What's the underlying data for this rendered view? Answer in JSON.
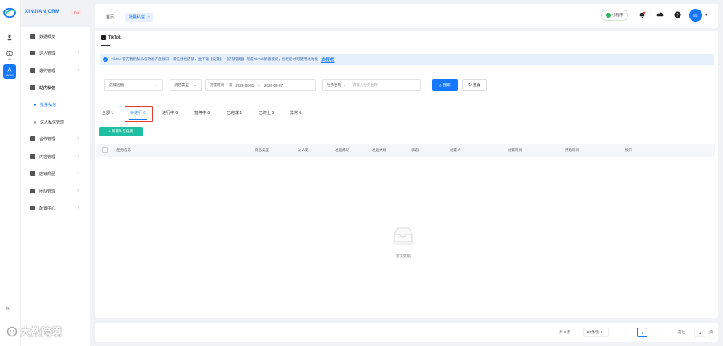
{
  "brand": {
    "name": "XINJIAN CRM",
    "badge": "Pro"
  },
  "rail": {
    "items": [
      {
        "label": "管",
        "icon": "people-icon"
      },
      {
        "label": "AI",
        "icon": "ai-icon"
      },
      {
        "label": "CRM",
        "icon": "crm-icon"
      }
    ]
  },
  "menu": {
    "items": [
      {
        "label": "数据概览",
        "icon": "dashboard-icon",
        "chevron": ""
      },
      {
        "label": "达人管理",
        "icon": "users-icon",
        "chevron": "›"
      },
      {
        "label": "邀约管理",
        "icon": "invite-icon",
        "chevron": "›"
      },
      {
        "label": "站内私信",
        "icon": "message-icon",
        "chevron": "⌄"
      },
      {
        "label": "批量私信",
        "icon": "",
        "chevron": ""
      },
      {
        "label": "达人私信管理",
        "icon": "",
        "chevron": ""
      },
      {
        "label": "合作管理",
        "icon": "cooperation-icon",
        "chevron": "›"
      },
      {
        "label": "内容管理",
        "icon": "content-icon",
        "chevron": "›"
      },
      {
        "label": "店铺商品",
        "icon": "shop-icon",
        "chevron": "›"
      },
      {
        "label": "团队管理",
        "icon": "team-icon",
        "chevron": "›"
      },
      {
        "label": "配置中心",
        "icon": "settings-icon",
        "chevron": "›"
      }
    ]
  },
  "watermark": "大数跨境",
  "topbar": {
    "tabs": [
      {
        "label": "首页"
      },
      {
        "label": "批量私信",
        "close": "×"
      }
    ],
    "mini_program": "小程序",
    "avatar": "8E",
    "caret": "▾"
  },
  "platform": {
    "label": "TikTok",
    "check": "✓"
  },
  "alert": {
    "icon": "i",
    "text": "TikTok 官方暂仍私私信功能开放接口，需先授权店铺，並下载【设置】-【店铺管理】完成TikTok新版授权，授权后才可使用此功能",
    "link": "去授权"
  },
  "filters": {
    "store": "选择店铺",
    "msg_type": "消息类型",
    "created_label": "创建时间",
    "date_start": "2026-08-01",
    "date_sep": "~",
    "date_end": "2026-08-07",
    "task_name": "任务名称",
    "task_placeholder": "请输入任务名称",
    "search": "搜索",
    "reset": "重置"
  },
  "status_tabs": [
    {
      "label": "全部 1"
    },
    {
      "label": "待进行 0"
    },
    {
      "label": "进行中 0"
    },
    {
      "label": "暂停中 0"
    },
    {
      "label": "已完成 1"
    },
    {
      "label": "已终止 0"
    },
    {
      "label": "异常 0"
    }
  ],
  "new_task": "+ 新增私信任务",
  "table": {
    "columns": [
      "任务信息",
      "消息类型",
      "达人数",
      "发送成功",
      "发送失败",
      "状态",
      "创建人",
      "创建时间",
      "开始时间",
      "操作"
    ],
    "empty": "暂无数据"
  },
  "pager": {
    "total": "共 0 条",
    "size": "20条/页",
    "size_caret": "▾",
    "prev": "‹",
    "current": "1",
    "next": "›",
    "goto": "前往",
    "jump": "1",
    "page_unit": "页"
  },
  "colors": {
    "accent": "#1677ff",
    "teal": "#1fbfa3",
    "highlight": "#e53935"
  }
}
